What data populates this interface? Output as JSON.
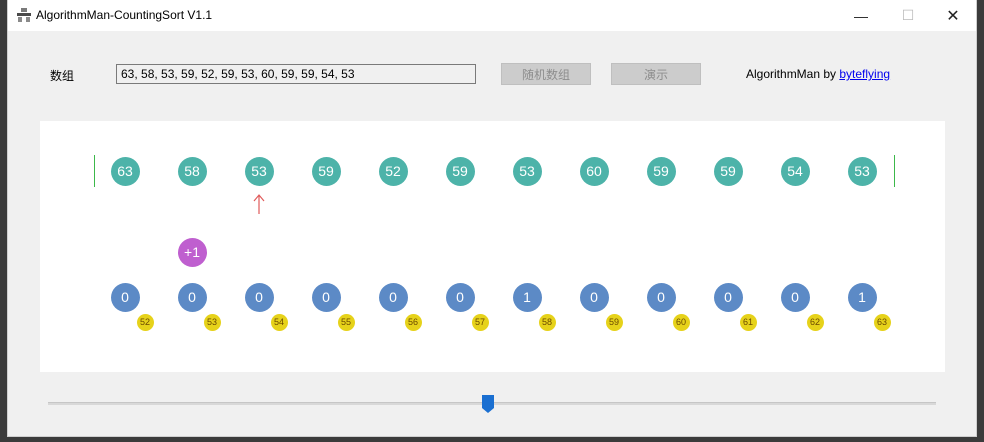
{
  "window": {
    "title": "AlgorithmMan-CountingSort V1.1",
    "minimize_symbol": "—",
    "maximize_symbol": "☐",
    "close_symbol": "✕"
  },
  "form": {
    "array_label": "数组",
    "array_value": "63, 58, 53, 59, 52, 59, 53, 60, 59, 59, 54, 53",
    "random_button": "随机数组",
    "demo_button": "演示",
    "credit_prefix": "AlgorithmMan by ",
    "credit_link": "byteflying"
  },
  "visualization": {
    "input_values": [
      "63",
      "58",
      "53",
      "59",
      "52",
      "59",
      "53",
      "60",
      "59",
      "59",
      "54",
      "53"
    ],
    "current_index": 2,
    "increment_badge": "+1",
    "increment_index": 1,
    "counts": [
      "0",
      "0",
      "0",
      "0",
      "0",
      "0",
      "1",
      "0",
      "0",
      "0",
      "0",
      "1"
    ],
    "count_keys": [
      "52",
      "53",
      "54",
      "55",
      "56",
      "57",
      "58",
      "59",
      "60",
      "61",
      "62",
      "63"
    ]
  },
  "slider": {
    "position": 0.495
  },
  "colors": {
    "input_circle": "#4db3a9",
    "count_circle": "#5c8ac6",
    "increment_circle": "#bf5fcf",
    "key_badge": "#e6d21a",
    "pointer_arrow": "#e05a5a",
    "boundary_bar": "#3cb84a",
    "slider_thumb": "#1a6fd1"
  }
}
